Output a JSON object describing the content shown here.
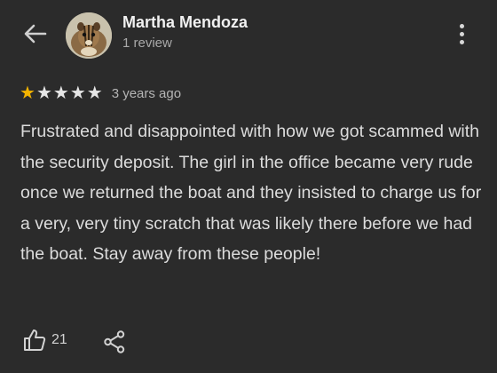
{
  "header": {
    "back_icon": "arrow-left-icon",
    "author_name": "Martha Mendoza",
    "review_count": "1 review",
    "menu_icon": "more-vertical-icon"
  },
  "review": {
    "rating": 1,
    "rating_max": 5,
    "time_ago": "3 years ago",
    "text": "Frustrated and disappointed with how we got scammed with the security deposit. The girl in the office became very rude once we returned the boat and they insisted to charge us for a very, very tiny scratch that was likely there before we had the boat. Stay away from these people!"
  },
  "actions": {
    "like_icon": "thumbs-up-icon",
    "like_count": "21",
    "share_icon": "share-icon"
  },
  "colors": {
    "background": "#2b2b2b",
    "star_filled": "#f4b400",
    "star_empty": "#e6e6e6"
  }
}
